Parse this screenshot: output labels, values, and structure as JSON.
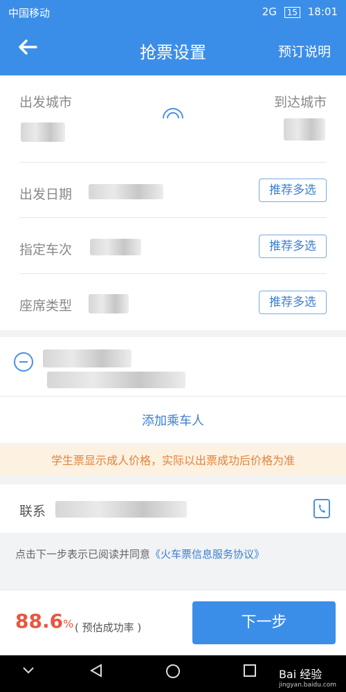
{
  "status": {
    "carrier": "中国移动",
    "time": "18:01",
    "battery": "15",
    "network": "2G"
  },
  "header": {
    "title": "抢票设置",
    "right_action": "预订说明"
  },
  "form": {
    "from_city_label": "出发城市",
    "to_city_label": "到达城市",
    "date_label": "出发日期",
    "train_label": "指定车次",
    "seat_label": "座席类型",
    "recommend_label": "推荐多选"
  },
  "passenger": {
    "add_label": "添加乘车人"
  },
  "notice": "学生票显示成人价格，实际以出票成功后价格为准",
  "contact": {
    "label": "联系"
  },
  "agreement": {
    "prefix": "点击下一步表示已阅读并同意",
    "link": "《火车票信息服务协议》"
  },
  "footer": {
    "rate_value": "88.6",
    "rate_unit": "%",
    "rate_label": "( 预估成功率 )",
    "next_label": "下一步"
  },
  "watermark": {
    "brand": "Bai 经验",
    "url": "jingyan.baidu.com"
  },
  "colors": {
    "primary": "#3b8ee8",
    "accent_red": "#e8563f",
    "notice_text": "#e2823b",
    "notice_bg": "#fdf1e1"
  }
}
